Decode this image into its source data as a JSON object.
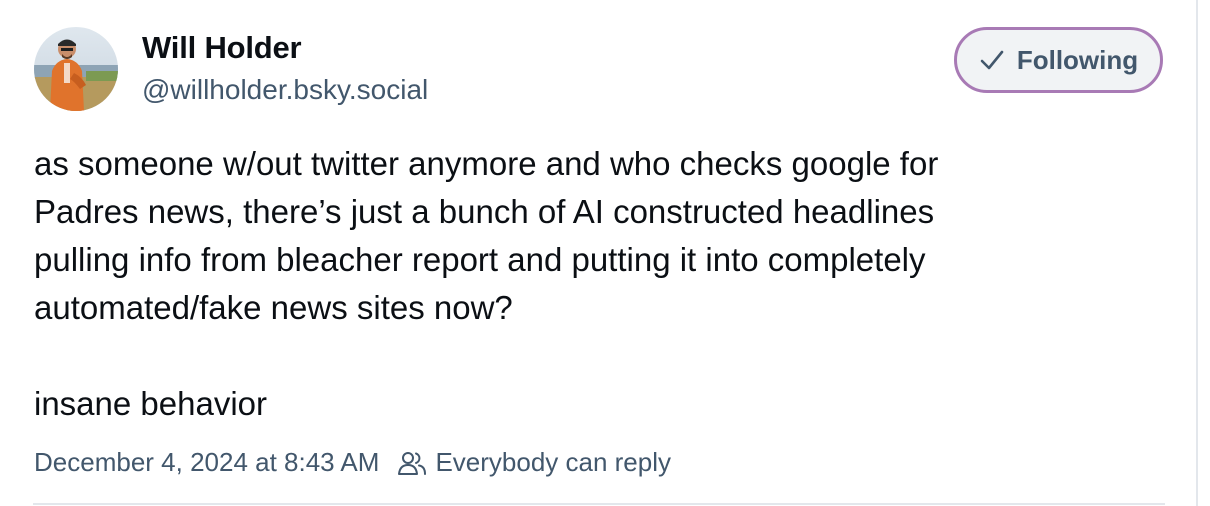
{
  "post": {
    "author": {
      "display_name": "Will Holder",
      "handle": "@willholder.bsky.social",
      "avatar_icon": "user-avatar-photo"
    },
    "follow_button": {
      "label": "Following",
      "icon": "check-icon",
      "border_color": "#a87ab5"
    },
    "text_lines": [
      "as someone w/out twitter anymore and who checks google for",
      "Padres news, there’s just a bunch of AI constructed headlines",
      "pulling info from bleacher report and putting it into completely",
      "automated/fake news sites now?"
    ],
    "text_final": "insane behavior",
    "timestamp": "December 4, 2024 at 8:43 AM",
    "reply_setting": {
      "icon": "people-icon",
      "label": "Everybody can reply"
    }
  }
}
